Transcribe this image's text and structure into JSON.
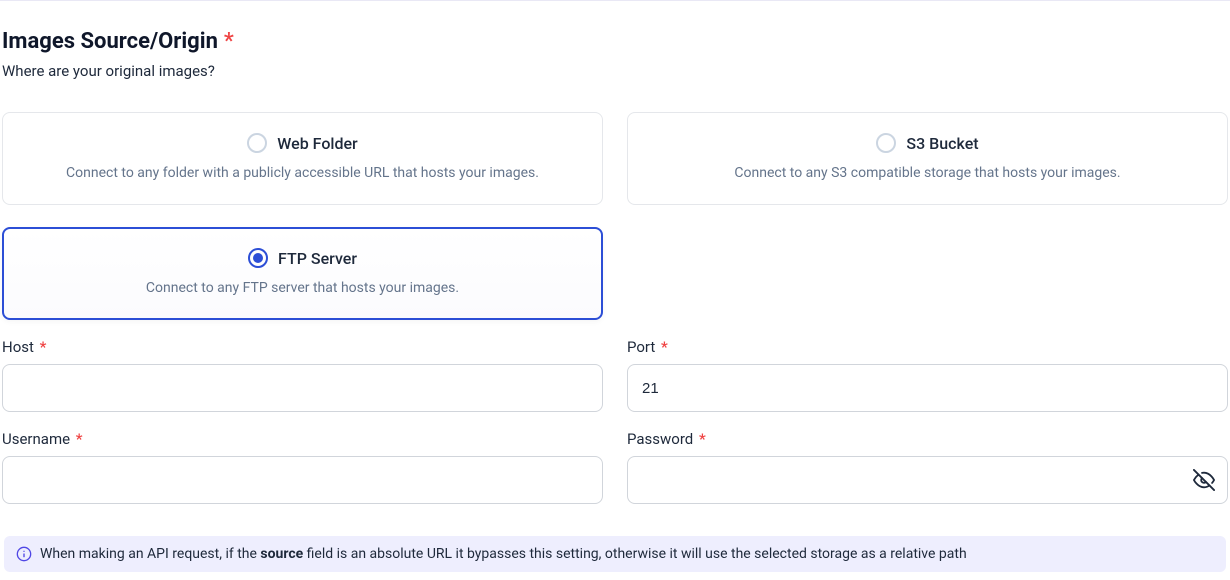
{
  "section": {
    "title": "Images Source/Origin",
    "required_mark": "*",
    "subtitle": "Where are your original images?"
  },
  "options": [
    {
      "id": "web-folder",
      "title": "Web Folder",
      "desc": "Connect to any folder with a publicly accessible URL that hosts your images.",
      "selected": false
    },
    {
      "id": "s3-bucket",
      "title": "S3 Bucket",
      "desc": "Connect to any S3 compatible storage that hosts your images.",
      "selected": false
    },
    {
      "id": "ftp-server",
      "title": "FTP Server",
      "desc": "Connect to any FTP server that hosts your images.",
      "selected": true
    }
  ],
  "fields": {
    "host": {
      "label": "Host",
      "required": "*",
      "value": ""
    },
    "port": {
      "label": "Port",
      "required": "*",
      "value": "21"
    },
    "username": {
      "label": "Username",
      "required": "*",
      "value": ""
    },
    "password": {
      "label": "Password",
      "required": "*",
      "value": ""
    }
  },
  "info": {
    "prefix": "When making an API request, if the ",
    "bold": "source",
    "suffix": " field is an absolute URL it bypasses this setting, otherwise it will use the selected storage as a relative path"
  }
}
